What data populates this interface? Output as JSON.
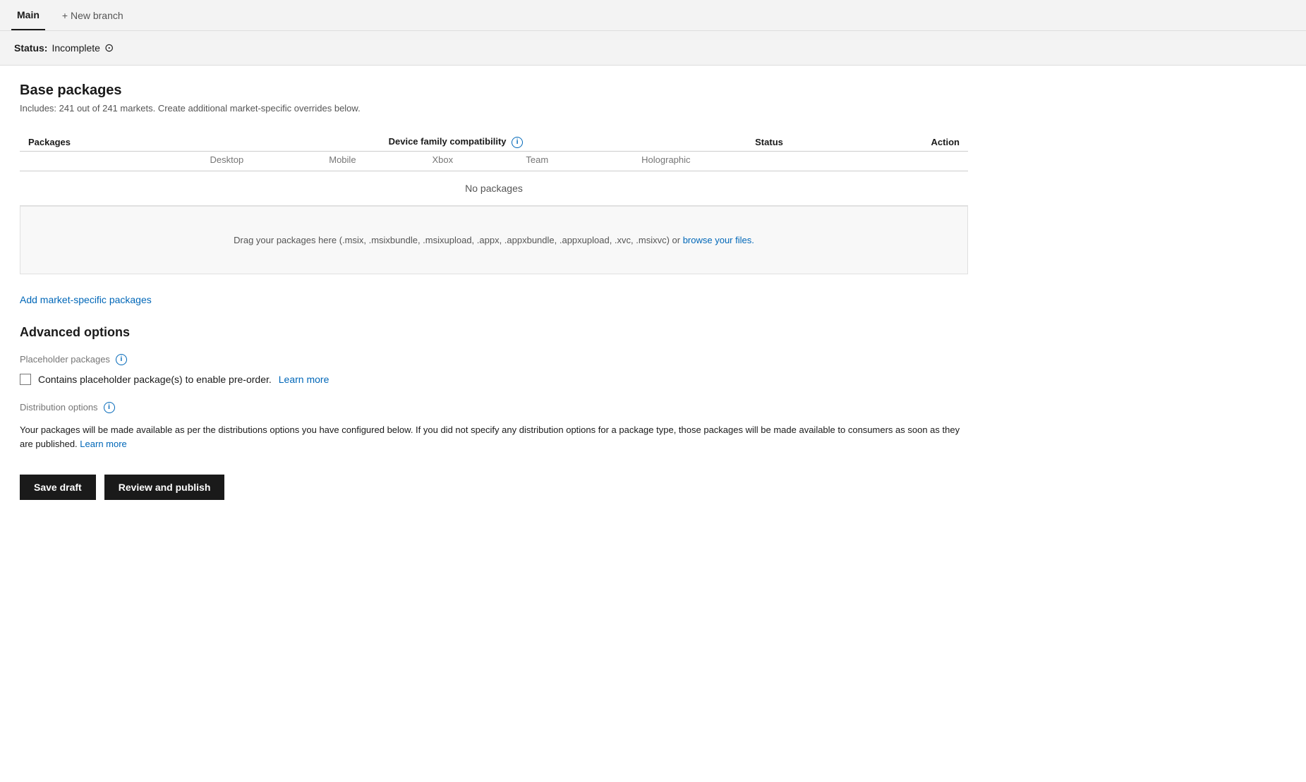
{
  "topbar": {
    "main_tab": "Main",
    "new_branch_label": "+ New branch"
  },
  "status_bar": {
    "label": "Status:",
    "value": "Incomplete",
    "icon": "⊙"
  },
  "base_packages": {
    "title": "Base packages",
    "subtitle_text": "Includes: 241 out of 241 markets. Create additional market-specific overrides below.",
    "subtitle_link": "Create additional market-specific overrides below.",
    "table": {
      "col_packages": "Packages",
      "col_dfc": "Device family compatibility",
      "col_dfc_info": "i",
      "col_status": "Status",
      "col_action": "Action",
      "sub_cols": [
        "Desktop",
        "Mobile",
        "Xbox",
        "Team",
        "Holographic"
      ],
      "no_packages_text": "No packages"
    },
    "drag_drop": {
      "text_before": "Drag your packages here (.msix, .msixbundle, .msixupload, .appx, .appxbundle, .appxupload, .xvc, .msixvc) or ",
      "link_text": "browse your files.",
      "text_after": ""
    }
  },
  "add_market_link": "Add market-specific packages",
  "advanced_options": {
    "title": "Advanced options",
    "placeholder_packages": {
      "label": "Placeholder packages",
      "info": "i",
      "checkbox_label": "Contains placeholder package(s) to enable pre-order.",
      "learn_more": "Learn more"
    },
    "distribution_options": {
      "label": "Distribution options",
      "info": "i",
      "description_text": "Your packages will be made available as per the distributions options you have configured below. If you did not specify any distribution options for a package type, those packages will be made available to consumers as soon as they are published.",
      "learn_more": "Learn more"
    }
  },
  "buttons": {
    "save_draft": "Save draft",
    "review_publish": "Review and publish"
  }
}
